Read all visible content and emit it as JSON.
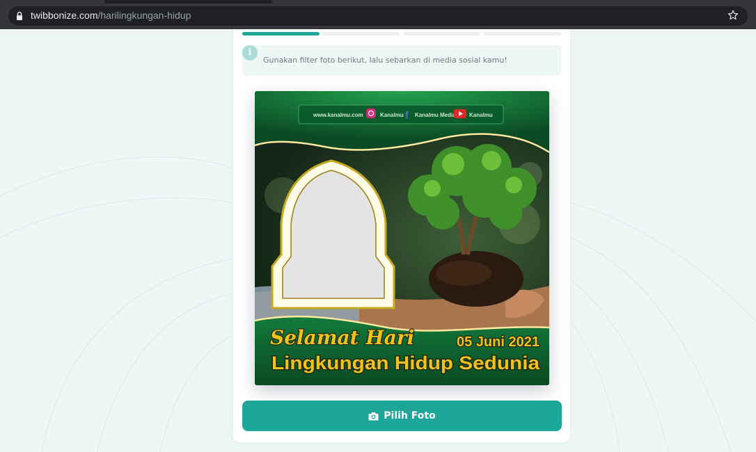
{
  "browser": {
    "domain": "twibbonize.com",
    "path": "/harilingkungan-hidup"
  },
  "instruction": {
    "icon": "info-icon",
    "icon_glyph": "i",
    "text": "Gunakan filter foto berikut, lalu sebarkan di media sosial kamu!"
  },
  "progress": {
    "completed_steps": 1,
    "total_steps": 4
  },
  "frame": {
    "website": "www.kanalmu.com",
    "instagram": "Kanalmu",
    "facebook": "Kanalmu Media",
    "youtube": "Kanalmu",
    "greeting": "Selamat Hari",
    "date": "05 Juni 2021",
    "title": "Lingkungan Hidup Sedunia"
  },
  "action": {
    "label": "Pilih Foto",
    "icon": "camera-icon"
  },
  "colors": {
    "accent": "#1da79a",
    "frame_green": "#0f5a2c",
    "gold_text": "#f2c21a"
  }
}
